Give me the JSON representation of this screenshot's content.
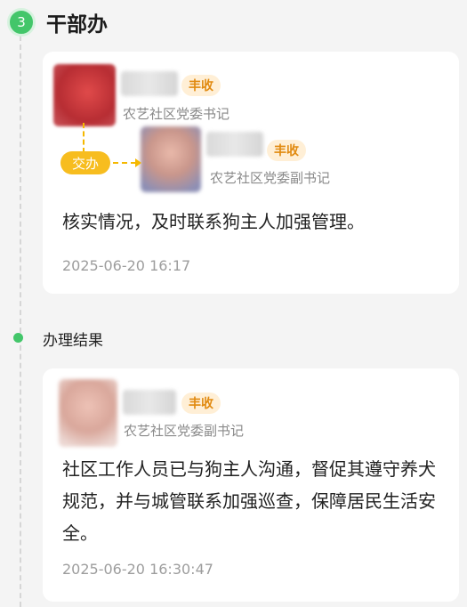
{
  "step": {
    "number": "3",
    "title": "干部办"
  },
  "record1": {
    "primary": {
      "tag": "丰收",
      "role": "农艺社区党委书记"
    },
    "handover_label": "交办",
    "secondary": {
      "tag": "丰收",
      "role": "农艺社区党委副书记"
    },
    "content": "核实情况，及时联系狗主人加强管理。",
    "time": "2025-06-20 16:17"
  },
  "result": {
    "label": "办理结果",
    "person": {
      "tag": "丰收",
      "role": "农艺社区党委副书记"
    },
    "content": "社区工作人员已与狗主人沟通，督促其遵守养犬规范，并与城管联系加强巡查，保障居民生活安全。",
    "time": "2025-06-20 16:30:47"
  },
  "colors": {
    "accent_green": "#43c66a",
    "tag_orange": "#e18a10",
    "handover_yellow": "#f7bd1f"
  }
}
